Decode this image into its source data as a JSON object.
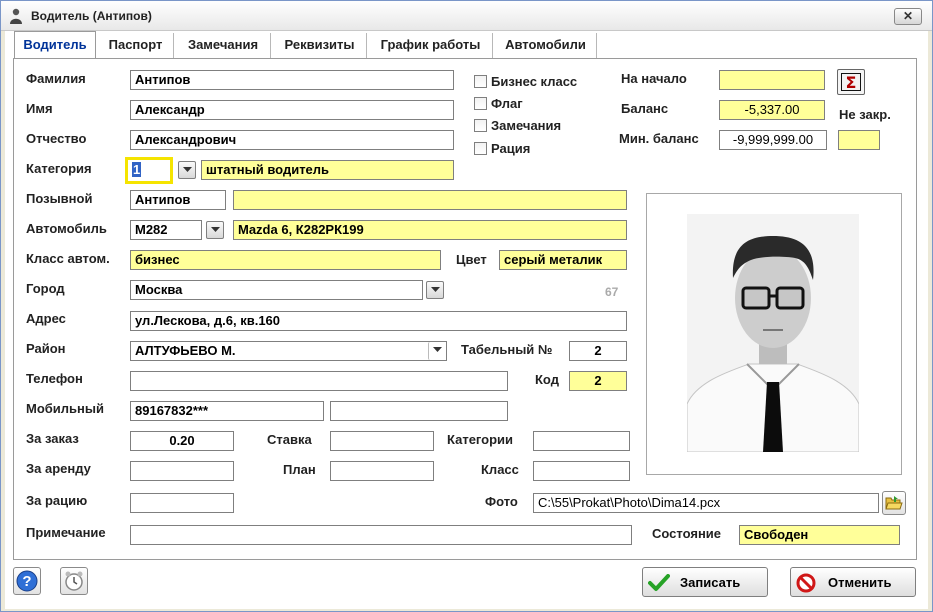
{
  "window": {
    "title": "Водитель  (Антипов)",
    "close_glyph": "✕"
  },
  "tabs": [
    "Водитель",
    "Паспорт",
    "Замечания",
    "Реквизиты",
    "График работы",
    "Автомобили"
  ],
  "fields": {
    "surname": {
      "label": "Фамилия",
      "value": "Антипов"
    },
    "name": {
      "label": "Имя",
      "value": "Александр"
    },
    "patronymic": {
      "label": "Отчество",
      "value": "Александрович"
    },
    "category": {
      "label": "Категория",
      "code": "1",
      "value": "штатный водитель"
    },
    "callsign": {
      "label": "Позывной",
      "value": "Антипов",
      "extra": ""
    },
    "car": {
      "label": "Автомобиль",
      "code": "М282",
      "value": "Mazda 6, К282РК199"
    },
    "car_class": {
      "label": "Класс автом.",
      "value": "бизнес"
    },
    "color": {
      "label": "Цвет",
      "value": "серый металик"
    },
    "city": {
      "label": "Город",
      "value": "Москва",
      "extra": "67"
    },
    "address": {
      "label": "Адрес",
      "value": "ул.Лескова, д.6, кв.160"
    },
    "district": {
      "label": "Район",
      "value": "АЛТУФЬЕВО М."
    },
    "tab_number": {
      "label": "Табельный №",
      "value": "2"
    },
    "phone": {
      "label": "Телефон",
      "value": ""
    },
    "code": {
      "label": "Код",
      "value": "2"
    },
    "mobile": {
      "label": "Мобильный",
      "value": "89167832***",
      "extra": ""
    },
    "per_order": {
      "label": "За заказ",
      "value": "0.20"
    },
    "rate": {
      "label": "Ставка",
      "value": ""
    },
    "categories": {
      "label": "Категории",
      "value": ""
    },
    "rent": {
      "label": "За аренду",
      "value": ""
    },
    "plan": {
      "label": "План",
      "value": ""
    },
    "class": {
      "label": "Класс",
      "value": ""
    },
    "radio_fee": {
      "label": "За рацию",
      "value": ""
    },
    "photo": {
      "label": "Фото",
      "value": "C:\\55\\Prokat\\Photo\\Dima14.pcx"
    },
    "note": {
      "label": "Примечание",
      "value": ""
    },
    "state": {
      "label": "Состояние",
      "value": "Свободен"
    }
  },
  "checkboxes": [
    {
      "label": "Бизнес класс",
      "checked": false
    },
    {
      "label": "Флаг",
      "checked": false
    },
    {
      "label": "Замечания",
      "checked": false
    },
    {
      "label": "Рация",
      "checked": false
    }
  ],
  "balance": {
    "start": {
      "label": "На начало",
      "value": ""
    },
    "balance": {
      "label": "Баланс",
      "value": "-5,337.00"
    },
    "min_balance": {
      "label": "Мин. баланс",
      "value": "-9,999,999.00"
    },
    "not_closed": {
      "label": "Не закр.",
      "value": ""
    },
    "sigma_glyph": "Σ"
  },
  "buttons": {
    "save": "Записать",
    "cancel": "Отменить"
  },
  "icons": {
    "title": "driver-icon",
    "sigma": "sigma-icon",
    "folder": "open-folder-icon",
    "help": "help-icon",
    "alarm": "alarm-clock-icon",
    "save": "checkmark-icon",
    "cancel": "cancel-icon"
  },
  "colors": {
    "highlight": "#FFFF99",
    "tab_active": "#003399",
    "sigma": "#B00000"
  }
}
